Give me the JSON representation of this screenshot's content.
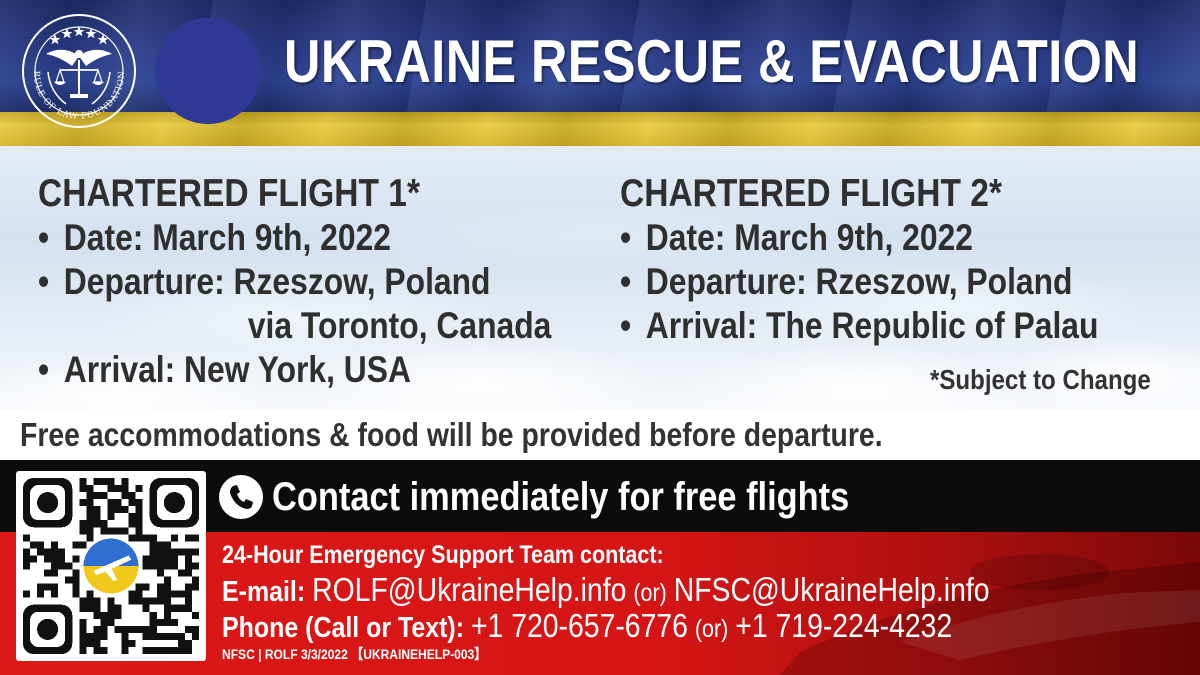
{
  "header": {
    "title": "UKRAINE RESCUE & EVACUATION",
    "seal_text": "RULE OF LAW FOUNDATION",
    "flag_colors": {
      "blue": "#2d4495",
      "yellow": "#e8c838"
    }
  },
  "flights": [
    {
      "heading": "CHARTERED FLIGHT 1*",
      "date": "Date: March 9th, 2022",
      "departure": "Departure: Rzeszow, Poland",
      "via": "via Toronto, Canada",
      "arrival": "Arrival: New York, USA"
    },
    {
      "heading": "CHARTERED FLIGHT 2*",
      "date": "Date: March 9th, 2022",
      "departure": "Departure: Rzeszow, Poland",
      "arrival": "Arrival: The Republic of Palau"
    }
  ],
  "bullet": "•",
  "note": "*Subject to Change",
  "accommodation": "Free accommodations & food will be provided before departure.",
  "contact": {
    "heading": "Contact immediately for free flights",
    "support": "24-Hour Emergency Support Team contact:",
    "email_label": "E-mail:",
    "email1": "ROLF@UkraineHelp.info",
    "or": "(or)",
    "email2": "NFSC@UkraineHelp.info",
    "phone_label": "Phone (Call or Text):",
    "phone1": "+1 720-657-6776",
    "phone2": "+1 719-224-4232",
    "footer": "NFSC | ROLF  3/3/2022 【UKRAINEHELP-003】",
    "accent_red": "#d51515"
  },
  "icons": [
    "seal-emblem-icon",
    "phone-icon",
    "qr-code-icon",
    "airplane-icon"
  ]
}
